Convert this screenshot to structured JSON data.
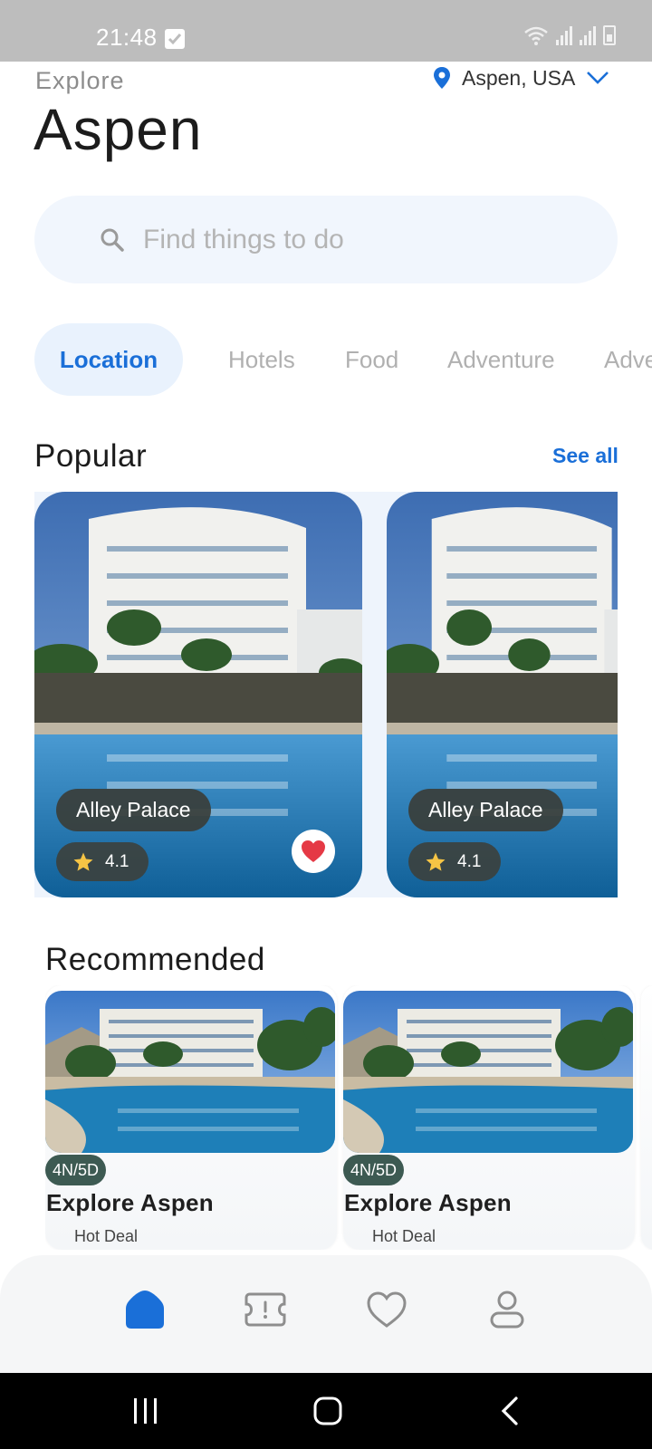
{
  "status_bar": {
    "time": "21:48"
  },
  "header": {
    "explore_label": "Explore",
    "city_title": "Aspen",
    "location": "Aspen, USA"
  },
  "search": {
    "placeholder": "Find things to do"
  },
  "categories": [
    {
      "label": "Location",
      "active": true
    },
    {
      "label": "Hotels",
      "active": false
    },
    {
      "label": "Food",
      "active": false
    },
    {
      "label": "Adventure",
      "active": false
    },
    {
      "label": "Adve",
      "active": false
    }
  ],
  "popular": {
    "title": "Popular",
    "see_all": "See all",
    "cards": [
      {
        "name": "Alley Palace",
        "rating": "4.1",
        "favorited": true
      },
      {
        "name": "Alley Palace",
        "rating": "4.1",
        "favorited": false
      }
    ]
  },
  "recommended": {
    "title": "Recommended",
    "cards": [
      {
        "tag": "4N/5D",
        "title": "Explore Aspen",
        "deal": "Hot Deal"
      },
      {
        "tag": "4N/5D",
        "title": "Explore Aspen",
        "deal": "Hot Deal"
      }
    ]
  },
  "bottom_nav": {
    "items": [
      {
        "icon": "home-icon",
        "active": true
      },
      {
        "icon": "ticket-icon",
        "active": false
      },
      {
        "icon": "heart-icon",
        "active": false
      },
      {
        "icon": "profile-icon",
        "active": false
      }
    ]
  },
  "colors": {
    "accent": "#1a6fd8",
    "search_bg": "#f1f6fd",
    "tag_bg": "#3d5a52",
    "heart": "#e53945"
  }
}
